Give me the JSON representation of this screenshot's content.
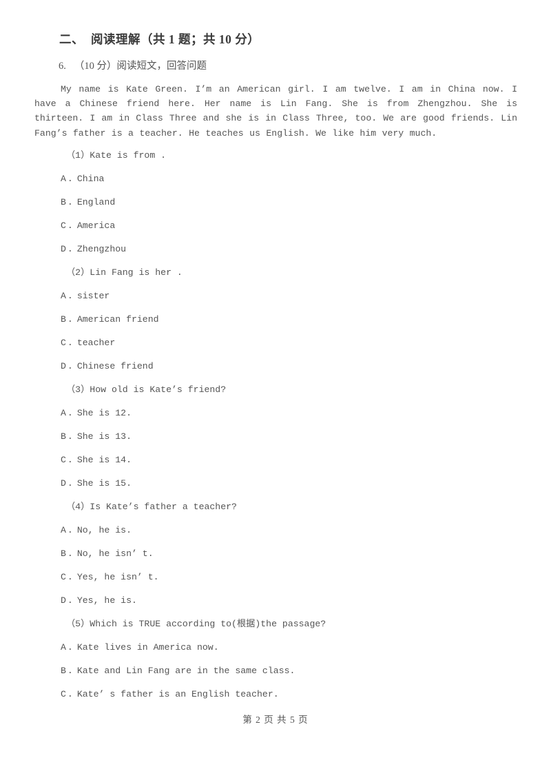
{
  "section": {
    "number": "二、",
    "title": "阅读理解（共 1 题；共 10 分）"
  },
  "question_block": {
    "number": "6.",
    "instruction": "（10 分）阅读短文，回答问题"
  },
  "passage": "My name is Kate Green. I’m an American girl. I am twelve. I am in China now. I have a Chinese friend here. Her name is Lin Fang. She is from Zhengzhou. She is thirteen. I am in Class Three and she is in Class Three, too. We are good friends. Lin Fang’s father is a teacher. He teaches us English. We like him very much.",
  "items": [
    {
      "stem": "（1）Kate is from   .",
      "options": [
        {
          "label": "A",
          "text": "China"
        },
        {
          "label": "B",
          "text": "England"
        },
        {
          "label": "C",
          "text": "America"
        },
        {
          "label": "D",
          "text": "Zhengzhou"
        }
      ]
    },
    {
      "stem": "（2）Lin Fang is her   .",
      "options": [
        {
          "label": "A",
          "text": "sister"
        },
        {
          "label": "B",
          "text": "American friend"
        },
        {
          "label": "C",
          "text": "teacher"
        },
        {
          "label": "D",
          "text": "Chinese friend"
        }
      ]
    },
    {
      "stem": "（3）How old is Kate’s friend?",
      "options": [
        {
          "label": "A",
          "text": "She is 12."
        },
        {
          "label": "B",
          "text": "She is 13."
        },
        {
          "label": "C",
          "text": "She is 14."
        },
        {
          "label": "D",
          "text": "She is 15."
        }
      ]
    },
    {
      "stem": "（4）Is Kate’s father a teacher?",
      "options": [
        {
          "label": "A",
          "text": "No, he is."
        },
        {
          "label": "B",
          "text": "No, he isn’ t."
        },
        {
          "label": "C",
          "text": "Yes, he isn’ t."
        },
        {
          "label": "D",
          "text": "Yes, he is."
        }
      ]
    },
    {
      "stem": "（5）Which is TRUE according to(根据)the passage?",
      "options": [
        {
          "label": "A",
          "text": "Kate lives in America now."
        },
        {
          "label": "B",
          "text": "Kate and Lin Fang are in the same class."
        },
        {
          "label": "C",
          "text": "Kate’ s father is an English teacher."
        }
      ]
    }
  ],
  "footer": {
    "text": "第 2 页 共 5 页"
  }
}
